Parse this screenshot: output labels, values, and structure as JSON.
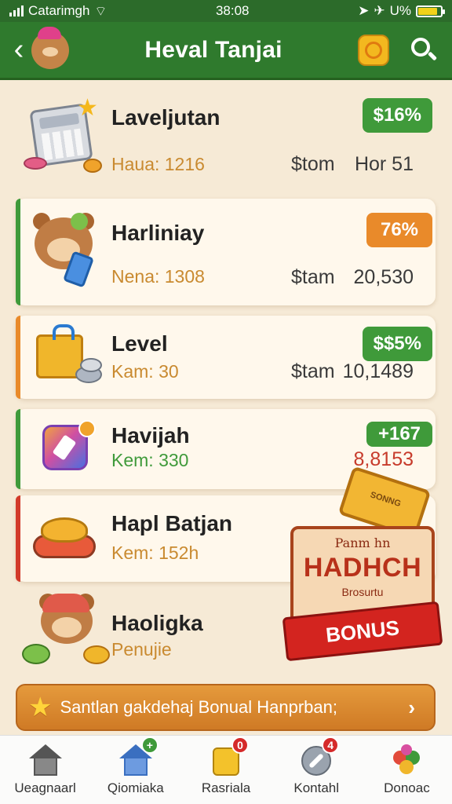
{
  "status_bar": {
    "carrier": "Catarimgh",
    "time": "38:08",
    "battery": "U%",
    "battery_level": 0.85
  },
  "header": {
    "title": "Heval Tanjai"
  },
  "cards": [
    {
      "title": "Laveljutan",
      "sub": "Haua: 1216",
      "mid": "$tom",
      "right": "Hor 51",
      "badge": "$16%",
      "badge_color": "#3f9a3a",
      "accent": "",
      "sub_color": "#c98a30"
    },
    {
      "title": "Harliniay",
      "sub": "Nena: 1308",
      "mid": "$tam",
      "right": "20,530",
      "badge": "76%",
      "badge_color": "#e98a2a",
      "accent": "#3f9a3a",
      "sub_color": "#c98a30"
    },
    {
      "title": "Level",
      "sub": "Kam: 30",
      "mid": "$tam",
      "right": "10,1489",
      "badge": "$$5%",
      "badge_color": "#3f9a3a",
      "accent": "#e98a2a",
      "sub_color": "#c98a30"
    },
    {
      "title": "Havijah",
      "sub": "Kem: 330",
      "mid": "",
      "right": "8,8153",
      "badge": "+167",
      "badge_color": "#3f9a3a",
      "accent": "#3f9a3a",
      "sub_color": "#3f9a3a",
      "right_color": "#c73b2b"
    },
    {
      "title": "Hapl Batjan",
      "sub": "Kem: 152h",
      "mid": "",
      "right": "",
      "badge": "",
      "badge_color": "",
      "accent": "#d23a2a",
      "sub_color": "#c98a30"
    },
    {
      "title": "Haoligka",
      "sub": "Penujie",
      "mid": "",
      "right": "",
      "badge": "",
      "badge_color": "",
      "accent": "",
      "sub_color": "#c98a30"
    }
  ],
  "bonus": {
    "ticket": "SONNG",
    "top": "Panm hn",
    "big": "HADHCH",
    "small": "Brosurtu",
    "ribbon": "BONUS"
  },
  "promo": {
    "text": "Santlan gakdehaj Bonual Hanprban;"
  },
  "bottom_nav": [
    {
      "label": "Ueagnaarl",
      "badge": "",
      "badge_color": ""
    },
    {
      "label": "Qiomiaka",
      "badge": "+",
      "badge_color": "#3f9a3a"
    },
    {
      "label": "Rasriala",
      "badge": "0",
      "badge_color": "#d52a2a"
    },
    {
      "label": "Kontahl",
      "badge": "4",
      "badge_color": "#d52a2a"
    },
    {
      "label": "Donoac",
      "badge": "",
      "badge_color": ""
    }
  ]
}
